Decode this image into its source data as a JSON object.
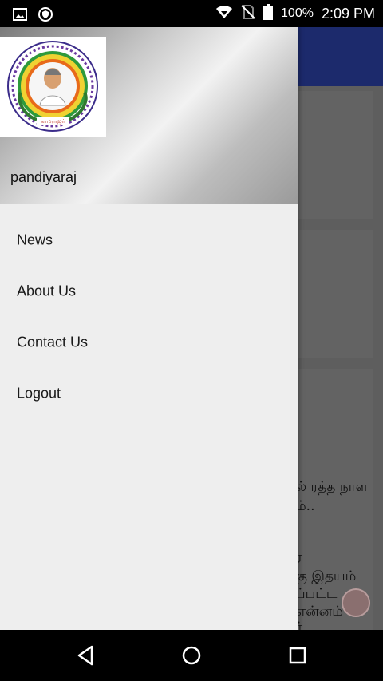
{
  "status_bar": {
    "icons_left": [
      "image-icon",
      "shield-icon"
    ],
    "icons_right": [
      "wifi-icon",
      "no-sim-icon",
      "battery-icon"
    ],
    "battery": "100%",
    "time": "2:09 PM"
  },
  "drawer": {
    "header": {
      "username": "pandiyaraj",
      "logo": "kamarajar-logo"
    },
    "menu": [
      {
        "label": "News"
      },
      {
        "label": "About Us"
      },
      {
        "label": "Contact Us"
      },
      {
        "label": "Logout"
      }
    ]
  },
  "background": {
    "text_lines": [
      "ல் ரத்த நாள",
      "ம்..",
      "ர",
      "கு இதயம்",
      "ப்பட்ட",
      "என்னம்",
      "ர்"
    ]
  },
  "nav_bar": {
    "buttons": [
      "back-icon",
      "home-icon",
      "recents-icon"
    ]
  },
  "colors": {
    "app_bar": "#1c2a6c",
    "drawer_bg": "#eeeeee",
    "scrim": "#5e5e5e"
  }
}
